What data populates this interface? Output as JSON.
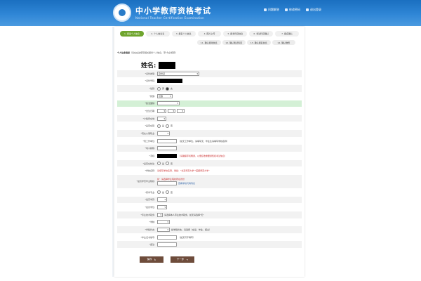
{
  "header": {
    "title": "中小学教师资格考试",
    "subtitle": "National Teacher Certification Examination",
    "links": [
      {
        "label": "问题解答",
        "icon": "help-icon"
      },
      {
        "label": "修改密码",
        "icon": "key-icon"
      },
      {
        "label": "退出登录",
        "icon": "logout-icon"
      }
    ]
  },
  "steps": [
    {
      "label": "1. 阅读个人信息"
    },
    {
      "label": "2. 个人信息表"
    },
    {
      "label": "3. 报名个人信息"
    },
    {
      "label": "4. 照片上传"
    },
    {
      "label": "5. 报考科目信息"
    },
    {
      "label": "6. 考试科目确认"
    },
    {
      "label": "7. 报名确认"
    }
  ],
  "steps2": [
    {
      "label": "11. 确认报考信息"
    },
    {
      "label": "12. 确认笔试科目"
    },
    {
      "label": "13. 确认报名信息"
    },
    {
      "label": "14. 确认缴费"
    }
  ],
  "notice": {
    "title": "个人信息填报",
    "text": "（请在右边填写相关报考个人信息，带*为必填项）"
  },
  "name": {
    "label": "姓名:"
  },
  "form": {
    "rows": [
      {
        "label": "*证件类型:",
        "value": "身份证"
      },
      {
        "label": "*证件号码:",
        "value": ""
      },
      {
        "label": "*性别:",
        "opt1": "男",
        "opt2": "女"
      },
      {
        "label": "*民族:",
        "value": "汉族"
      },
      {
        "label": "*政治面貌:",
        "value": ""
      },
      {
        "label": "*出生日期:",
        "value": ""
      },
      {
        "label": "*户籍所在地:",
        "value": ""
      },
      {
        "label": "*是否在职:",
        "opt1": "是",
        "opt2": "否"
      },
      {
        "label": "*现在从事职业:",
        "value": ""
      },
      {
        "label": "*现工作单位:",
        "note": "（如无工作单位，请填写无，毕业生请填写学校名称）"
      },
      {
        "label": "*电子邮箱:",
        "value": ""
      },
      {
        "label": "*手机:",
        "note": "（请确保手机畅通，以便接收重要通知和考试信息）"
      },
      {
        "label": "*是否在校生:",
        "opt1": "是",
        "opt2": "否"
      },
      {
        "label": "*学校名称:",
        "note": "请填写学校名称，例如：\"北京师范大学\"\"首都师范大学\""
      },
      {
        "label": "*最高学历毕业院校:",
        "hint": "查看学校代码列表",
        "note": "如：请选择毕业院校所在省份"
      },
      {
        "label": "*所学专业:",
        "opt1": "是",
        "opt2": "否"
      },
      {
        "label": "*最高学历:",
        "value": ""
      },
      {
        "label": "*最高学位:",
        "value": ""
      },
      {
        "label": "*专业技术职务:",
        "note": "请选择本人专业技术职务，如无请选择\"无\""
      },
      {
        "label": "*学制:",
        "value": ""
      },
      {
        "label": "*学籍状态:",
        "note": "如学籍状态，请选择（在读、毕业、结业）"
      },
      {
        "label": "*毕业证书编号:",
        "note": "（如无可不填写）"
      },
      {
        "label": "*备注:",
        "value": ""
      }
    ]
  },
  "buttons": {
    "save": "保存",
    "next": "下一步"
  }
}
